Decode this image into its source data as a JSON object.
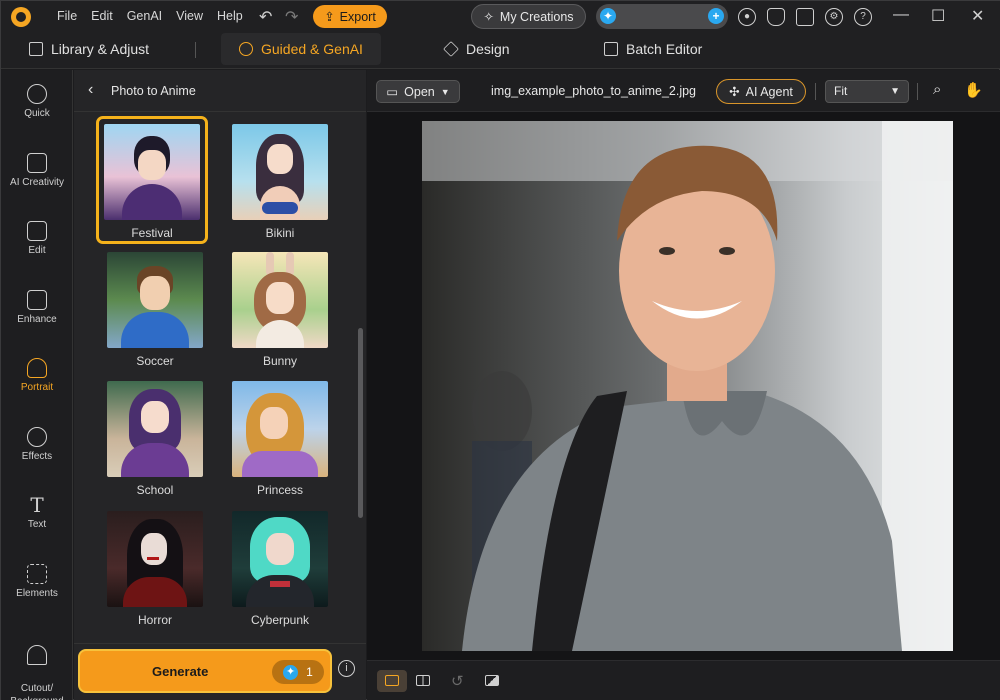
{
  "titlebar": {
    "menu": [
      "File",
      "Edit",
      "GenAI",
      "View",
      "Help"
    ],
    "export_label": "Export",
    "mycreations_label": "My Creations",
    "icons": [
      "account-icon",
      "notification-icon",
      "megaphone-icon",
      "settings-icon",
      "help-icon"
    ]
  },
  "modes": [
    {
      "label": "Library & Adjust",
      "icon": "library-icon"
    },
    {
      "label": "Guided & GenAI",
      "icon": "magic-wand-icon",
      "active": true
    },
    {
      "label": "Design",
      "icon": "layers-icon"
    },
    {
      "label": "Batch Editor",
      "icon": "batch-image-icon"
    }
  ],
  "rail": [
    {
      "label": "Quick",
      "icon": "quick-wand-icon"
    },
    {
      "label": "AI Creativity",
      "icon": "ai-creativity-icon"
    },
    {
      "label": "Edit",
      "icon": "edit-image-icon"
    },
    {
      "label": "Enhance",
      "icon": "enhance-icon"
    },
    {
      "label": "Portrait",
      "icon": "portrait-icon",
      "active": true
    },
    {
      "label": "Effects",
      "icon": "effects-icon"
    },
    {
      "label": "Text",
      "icon": "text-icon"
    },
    {
      "label": "Elements",
      "icon": "elements-icon"
    },
    {
      "label": "Cutout/\nBackground",
      "icon": "cutout-icon"
    }
  ],
  "panel": {
    "title": "Photo to Anime",
    "styles": [
      {
        "label": "Festival",
        "selected": true
      },
      {
        "label": "Bikini"
      },
      {
        "label": "Soccer"
      },
      {
        "label": "Bunny"
      },
      {
        "label": "School"
      },
      {
        "label": "Princess"
      },
      {
        "label": "Horror"
      },
      {
        "label": "Cyberpunk"
      }
    ],
    "generate_label": "Generate",
    "generate_cost": "1"
  },
  "canvas": {
    "open_label": "Open",
    "filename": "img_example_photo_to_anime_2.jpg",
    "agent_label": "AI Agent",
    "zoom": "Fit"
  },
  "colors": {
    "accent": "#f59a1b",
    "credit": "#2aa8f0"
  }
}
